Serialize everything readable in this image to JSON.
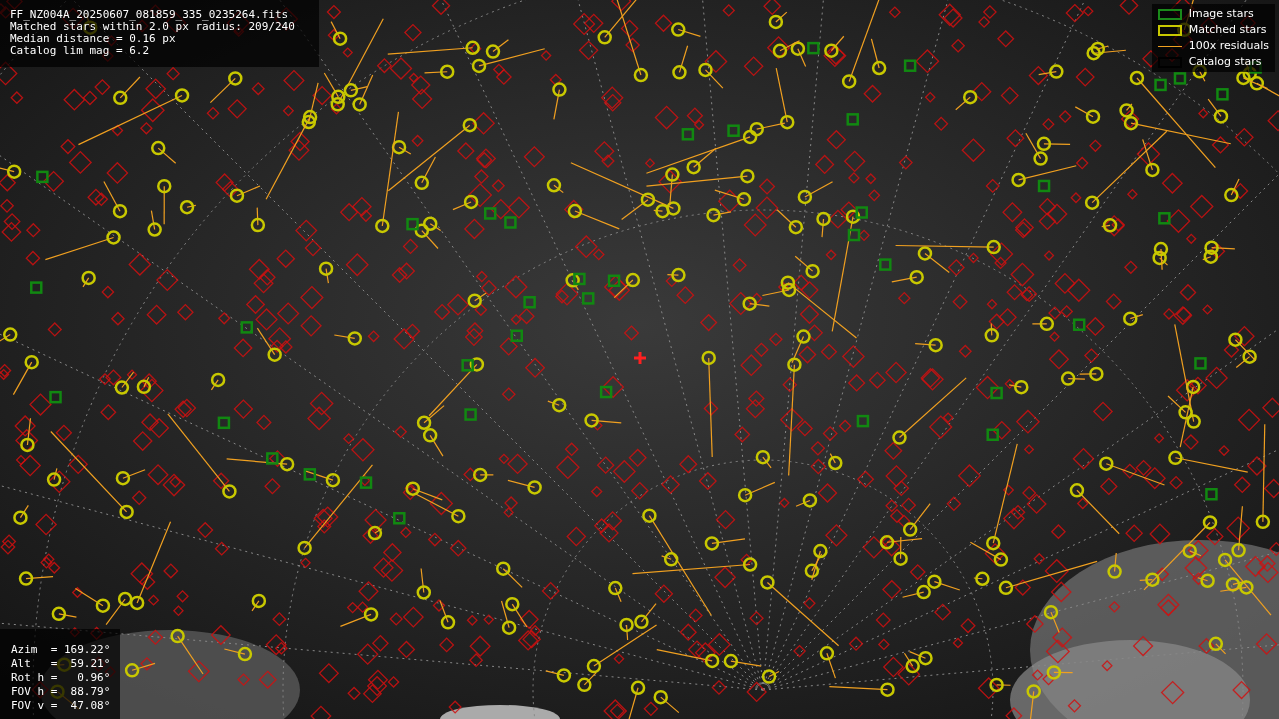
{
  "info_panel": {
    "lines": [
      "FF_NZ004A_20250607_081859_335_0235264.fits",
      "Matched stars within 2.0 px radius: 209/240",
      "Median distance = 0.16 px",
      "Catalog lim mag = 6.2"
    ]
  },
  "legend": [
    {
      "kind": "image_stars",
      "label": "Image stars"
    },
    {
      "kind": "matched_stars",
      "label": "Matched stars"
    },
    {
      "kind": "residuals",
      "label": "100x residuals"
    },
    {
      "kind": "catalog_stars",
      "label": "Catalog stars"
    }
  ],
  "pointing_panel": {
    "lines": [
      "Azim  = 169.22°",
      "Alt   =  59.21°",
      "Rot h =   0.96°",
      "FOV h =  88.79°",
      "FOV v =  47.08°"
    ]
  }
}
